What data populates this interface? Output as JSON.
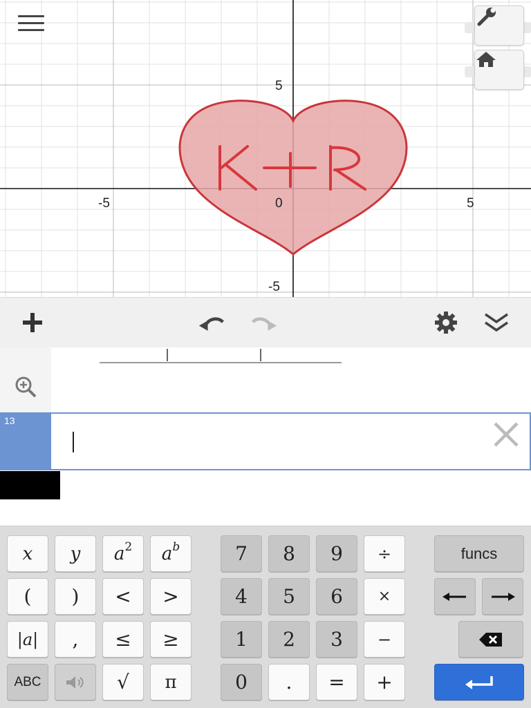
{
  "graph": {
    "x_tick_labels": [
      "-5",
      "0",
      "5"
    ],
    "y_tick_labels": [
      "5",
      "-5"
    ],
    "heart_text": "K+R",
    "fill_color": "#e8a7a7",
    "stroke_color": "#c8363b",
    "icons": {
      "menu": "hamburger-icon",
      "settings": "wrench-icon",
      "home": "home-icon"
    }
  },
  "toolbar": {
    "icons": {
      "add": "plus-icon",
      "undo": "undo-icon",
      "redo": "redo-icon",
      "settings": "gear-icon",
      "collapse": "double-chevron-down-icon"
    }
  },
  "expressions": {
    "active_row_number": "13",
    "active_row_value": "",
    "zoom_icon": "zoom-in-icon",
    "delete_icon": "close-icon"
  },
  "keypad": {
    "row1": [
      "x",
      "y",
      "a2",
      "ab",
      "7",
      "8",
      "9",
      "÷",
      "funcs"
    ],
    "row2": [
      "(",
      ")",
      "<",
      ">",
      "4",
      "5",
      "6",
      "×",
      "←",
      "→"
    ],
    "row3": [
      "|a|",
      ",",
      "≤",
      "≥",
      "1",
      "2",
      "3",
      "−",
      "⌫"
    ],
    "row4": [
      "ABC",
      "🔈",
      "√",
      "π",
      "0",
      ".",
      "=",
      "+",
      "↵"
    ],
    "labels": {
      "x": "x",
      "y": "y",
      "a": "a",
      "sq_exp": "2",
      "b_exp": "b",
      "seven": "7",
      "eight": "8",
      "nine": "9",
      "divide": "÷",
      "funcs": "funcs",
      "lparen": "(",
      "rparen": ")",
      "lt": "<",
      "gt": ">",
      "four": "4",
      "five": "5",
      "six": "6",
      "times": "×",
      "abs": "|a|",
      "comma": ",",
      "le": "≤",
      "ge": "≥",
      "one": "1",
      "two": "2",
      "three": "3",
      "minus": "−",
      "abc": "ABC",
      "sqrt": "√",
      "pi": "π",
      "zero": "0",
      "dot": ".",
      "equals": "=",
      "plus": "+"
    },
    "accent": "#2f6fd8"
  }
}
